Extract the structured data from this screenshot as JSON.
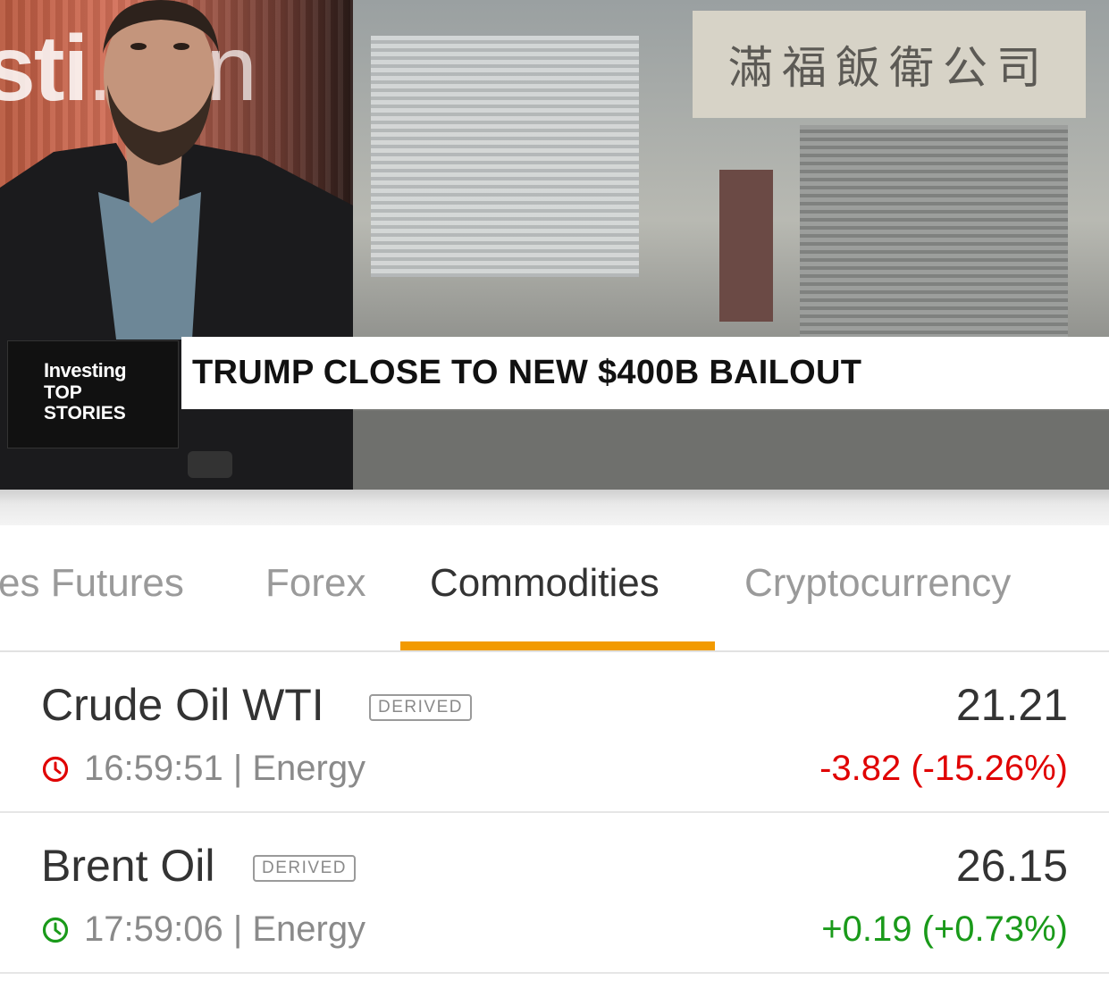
{
  "video": {
    "studio_logo_bold": "sti",
    "studio_logo_light": ".con",
    "storefront_sign": "滿福飯衛公司",
    "brand_line1": "Investing",
    "brand_line2": "TOP",
    "brand_line3": "STORIES",
    "headline": "TRUMP CLOSE TO NEW $400B BAILOUT"
  },
  "tabs": {
    "items": [
      {
        "label": "es Futures"
      },
      {
        "label": "Forex"
      },
      {
        "label": "Commodities"
      },
      {
        "label": "Cryptocurrency"
      }
    ],
    "active": "Commodities",
    "accent_color": "#f29a00"
  },
  "quotes": [
    {
      "name": "Crude Oil WTI",
      "badge": "DERIVED",
      "last": "21.21",
      "meta": "16:59:51 | Energy",
      "change": "-3.82 (-15.26%)",
      "change_color": "#e00000",
      "clock_color": "#e00000",
      "icon": "clock-icon"
    },
    {
      "name": "Brent Oil",
      "badge": "DERIVED",
      "last": "26.15",
      "meta": "17:59:06 | Energy",
      "change": "+0.19 (+0.73%)",
      "change_color": "#1a9a1a",
      "clock_color": "#1a9a1a",
      "icon": "clock-icon"
    }
  ]
}
